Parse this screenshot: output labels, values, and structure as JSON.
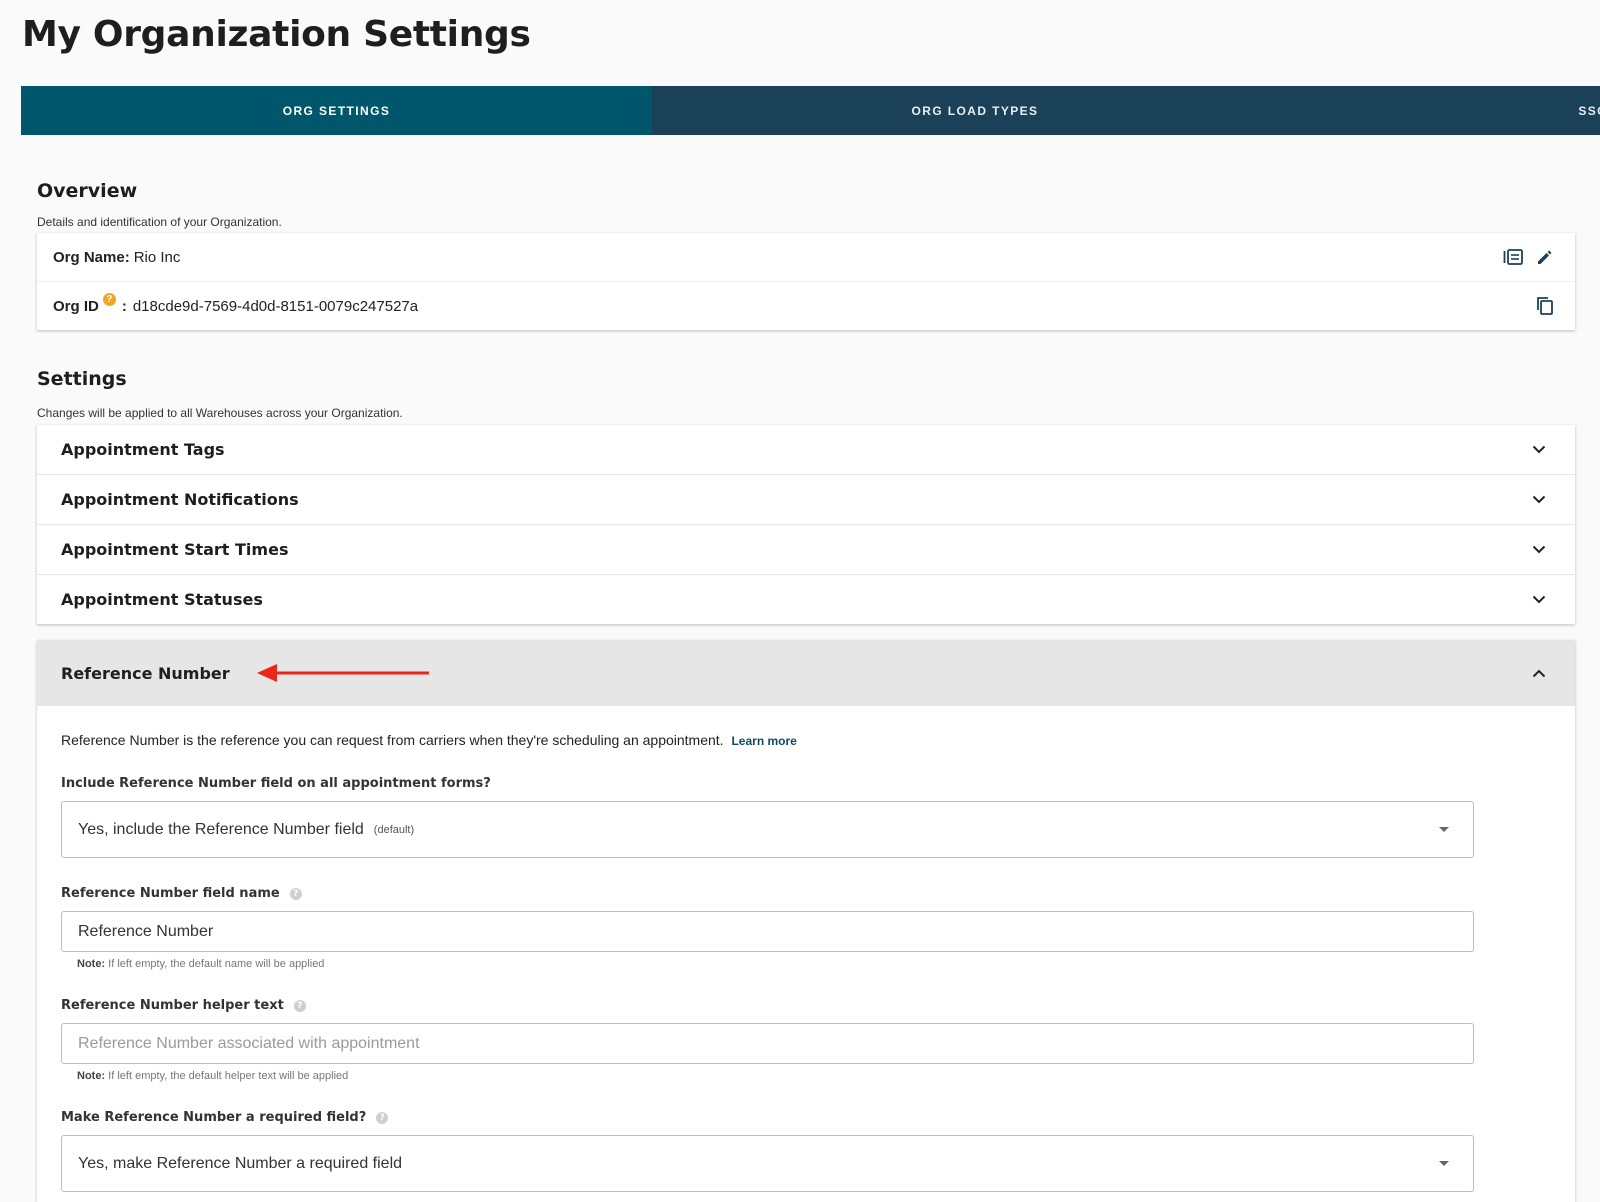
{
  "page": {
    "title": "My Organization Settings"
  },
  "tabs": [
    {
      "label": "ORG SETTINGS",
      "active": true
    },
    {
      "label": "ORG LOAD TYPES",
      "active": false
    },
    {
      "label": "SSO S",
      "active": false
    }
  ],
  "overview": {
    "title": "Overview",
    "subtitle": "Details and identification of your Organization.",
    "org_name_label": "Org Name:",
    "org_name_value": "Rio Inc",
    "org_id_label": "Org ID",
    "org_id_help": "?",
    "org_id_sep": ":",
    "org_id_value": "d18cde9d-7569-4d0d-8151-0079c247527a"
  },
  "settings": {
    "title": "Settings",
    "subtitle": "Changes will be applied to all Warehouses across your Organization.",
    "accordion": [
      {
        "label": "Appointment Tags"
      },
      {
        "label": "Appointment Notifications"
      },
      {
        "label": "Appointment Start Times"
      },
      {
        "label": "Appointment Statuses"
      }
    ]
  },
  "reference_number": {
    "header": "Reference Number",
    "description": "Reference Number is the reference you can request from carriers when they're scheduling an appointment.",
    "learn_more": "Learn more",
    "include_label": "Include Reference Number field on all appointment forms?",
    "include_value": "Yes, include the Reference Number field",
    "include_default_tag": "(default)",
    "field_name_label": "Reference Number field name",
    "field_name_value": "Reference Number",
    "field_name_note_bold": "Note:",
    "field_name_note": "If left empty, the default name will be applied",
    "helper_label": "Reference Number helper text",
    "helper_placeholder": "Reference Number associated with appointment",
    "helper_note_bold": "Note:",
    "helper_note": "If left empty, the default helper text will be applied",
    "required_label": "Make Reference Number a required field?",
    "required_value": "Yes, make Reference Number a required field"
  },
  "colors": {
    "tab_bar": "#1b4158",
    "tab_active": "#00566b",
    "help_orange": "#f2a32a",
    "annotation_red": "#e8261c"
  },
  "icons": {
    "edit_list": "list-edit-icon",
    "edit": "pencil-icon",
    "copy": "copy-icon",
    "chevron_down": "chevron-down-icon",
    "chevron_up": "chevron-up-icon"
  }
}
